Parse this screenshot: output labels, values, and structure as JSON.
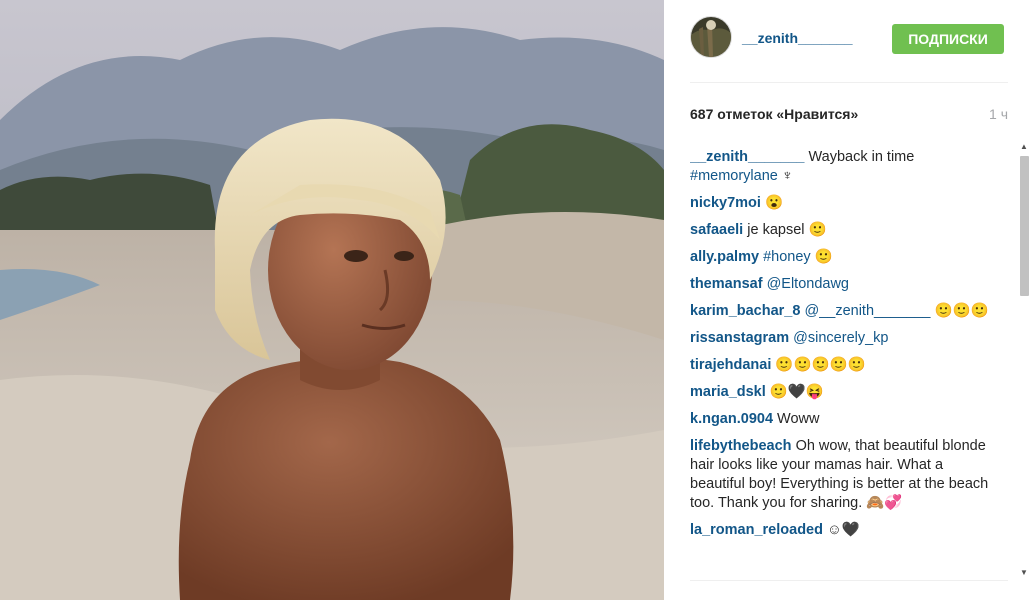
{
  "post": {
    "image_description_icon": "photo-boy-on-beach",
    "username": "__zenith_______",
    "follow_label": "ПОДПИСКИ",
    "likes": "687 отметок «Нравится»",
    "time_ago": "1 ч"
  },
  "colors": {
    "link": "#125688",
    "follow": "#70c050",
    "muted": "#a5a7aa"
  },
  "comments": [
    {
      "user": "__zenith_______",
      "text": "Wayback in time",
      "link": "#memorylane",
      "tail": "♆"
    },
    {
      "user": "nicky7moi",
      "text": "😮"
    },
    {
      "user": "safaaeli",
      "text": "je kapsel 🙂"
    },
    {
      "user": "ally.palmy",
      "link": "#honey",
      "tail": "🙂"
    },
    {
      "user": "themansaf",
      "link": "@Eltondawg"
    },
    {
      "user": "karim_bachar_8",
      "link": "@__zenith_______",
      "tail": "🙂🙂🙂"
    },
    {
      "user": "rissanstagram",
      "link": "@sincerely_kp"
    },
    {
      "user": "tirajehdanai",
      "text": "🙂🙂🙂🙂🙂"
    },
    {
      "user": "maria_dskl",
      "text": "🙂🖤😝"
    },
    {
      "user": "k.ngan.0904",
      "text": "Woww"
    },
    {
      "user": "lifebythebeach",
      "text": "Oh wow, that beautiful blonde hair looks like your mamas hair. What a beautiful boy! Everything is better at the beach too. Thank you for sharing. 🙈💞"
    },
    {
      "user": "la_roman_reloaded",
      "text": "☺🖤"
    }
  ]
}
